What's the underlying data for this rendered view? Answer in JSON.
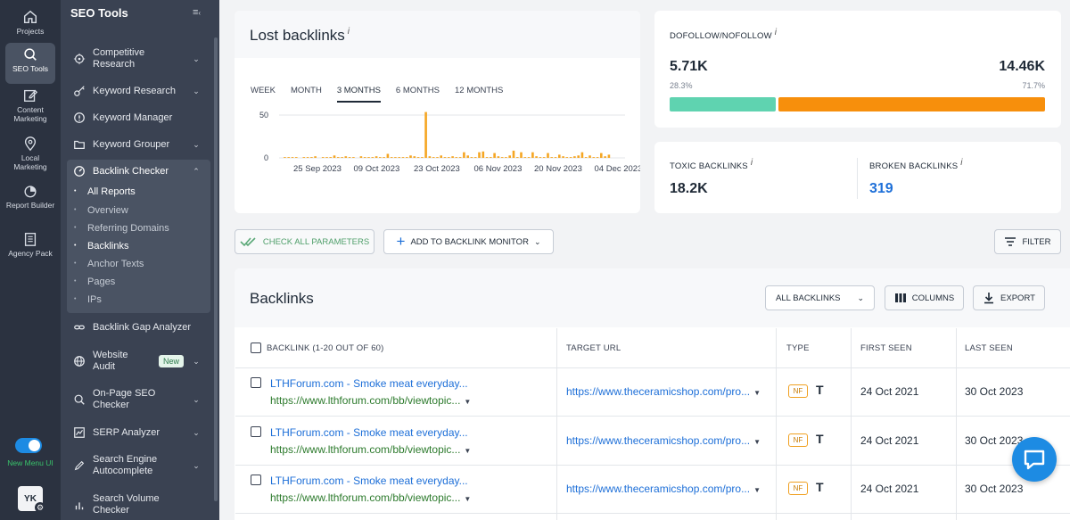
{
  "rail": {
    "items": [
      {
        "label": "Projects",
        "icon": "home-icon"
      },
      {
        "label": "SEO Tools",
        "icon": "search-icon"
      },
      {
        "label": "Content Marketing",
        "icon": "edit-icon"
      },
      {
        "label": "Local Marketing",
        "icon": "location-pin-icon"
      },
      {
        "label": "Report Builder",
        "icon": "pie-chart-icon"
      },
      {
        "label": "Agency Pack",
        "icon": "building-icon"
      }
    ],
    "toggle_label": "New Menu UI",
    "avatar": "YK"
  },
  "sidebar": {
    "title": "SEO Tools",
    "items": {
      "competitive": "Competitive Research",
      "keyword_research": "Keyword Research",
      "keyword_manager": "Keyword Manager",
      "keyword_grouper": "Keyword Grouper",
      "backlink_checker": "Backlink Checker",
      "backlink_gap": "Backlink Gap Analyzer",
      "website_audit": "Website Audit",
      "website_audit_badge": "New",
      "onpage": "On-Page SEO Checker",
      "serp": "SERP Analyzer",
      "sea": "Search Engine Autocomplete",
      "svc": "Search Volume Checker"
    },
    "subitems": [
      "All Reports",
      "Overview",
      "Referring Domains",
      "Backlinks",
      "Anchor Texts",
      "Pages",
      "IPs"
    ]
  },
  "lost": {
    "title": "Lost backlinks",
    "info": "i",
    "tabs": [
      "WEEK",
      "MONTH",
      "3 MONTHS",
      "6 MONTHS",
      "12 MONTHS"
    ],
    "active_tab": "3 MONTHS"
  },
  "chart_data": {
    "type": "bar",
    "y_ticks": [
      "50",
      "0"
    ],
    "ylim": [
      0,
      60
    ],
    "x_tick_labels": [
      "25 Sep 2023",
      "09 Oct 2023",
      "23 Oct 2023",
      "06 Nov 2023",
      "20 Nov 2023",
      "04 Dec 2023"
    ],
    "values": [
      0,
      1,
      1,
      1,
      1,
      0,
      1,
      1,
      1,
      2,
      0,
      1,
      1,
      1,
      3,
      1,
      1,
      2,
      1,
      1,
      0,
      2,
      1,
      1,
      1,
      2,
      1,
      1,
      5,
      1,
      1,
      1,
      1,
      1,
      3,
      2,
      1,
      1,
      57,
      2,
      1,
      1,
      3,
      1,
      1,
      2,
      1,
      1,
      7,
      3,
      1,
      1,
      7,
      8,
      1,
      1,
      6,
      2,
      1,
      1,
      3,
      9,
      1,
      7,
      1,
      1,
      7,
      2,
      1,
      1,
      6,
      1,
      1,
      4,
      2,
      1,
      1,
      2,
      3,
      7,
      1,
      3,
      1,
      1,
      6,
      2,
      4
    ],
    "colors": {
      "bar": "#f5a623",
      "grid": "#e3e6ea"
    }
  },
  "dofollow": {
    "title": "DOFOLLOW/NOFOLLOW",
    "info": "i",
    "left_value": "5.71K",
    "left_pct": "28.3%",
    "right_value": "14.46K",
    "right_pct": "71.7%",
    "left_fraction": 0.283,
    "colors": {
      "left": "#5fd3b0",
      "right": "#f78f0c"
    }
  },
  "toxic": {
    "label": "TOXIC BACKLINKS",
    "info": "i",
    "value": "18.2K"
  },
  "broken": {
    "label": "BROKEN BACKLINKS",
    "info": "i",
    "value": "319"
  },
  "actions": {
    "check_all": "CHECK ALL PARAMETERS",
    "add_monitor": "ADD TO BACKLINK MONITOR",
    "filter": "FILTER"
  },
  "backlinks": {
    "title": "Backlinks",
    "select": "ALL BACKLINKS",
    "columns": "COLUMNS",
    "export": "EXPORT",
    "headers": {
      "backlink": "BACKLINK (1-20 OUT OF 60)",
      "target": "TARGET URL",
      "type": "TYPE",
      "first": "FIRST SEEN",
      "last": "LAST SEEN"
    },
    "rows": [
      {
        "title": "LTHForum.com - Smoke meat everyday...",
        "url": "https://www.lthforum.com/bb/viewtopic...",
        "target": "https://www.theceramicshop.com/pro...",
        "type_badge": "NF",
        "type_icon": "T",
        "first": "24 Oct 2021",
        "last": "30 Oct 2023"
      },
      {
        "title": "LTHForum.com - Smoke meat everyday...",
        "url": "https://www.lthforum.com/bb/viewtopic...",
        "target": "https://www.theceramicshop.com/pro...",
        "type_badge": "NF",
        "type_icon": "T",
        "first": "24 Oct 2021",
        "last": "30 Oct 2023"
      },
      {
        "title": "LTHForum.com - Smoke meat everyday...",
        "url": "https://www.lthforum.com/bb/viewtopic...",
        "target": "https://www.theceramicshop.com/pro...",
        "type_badge": "NF",
        "type_icon": "T",
        "first": "24 Oct 2021",
        "last": "30 Oct 2023"
      }
    ]
  }
}
